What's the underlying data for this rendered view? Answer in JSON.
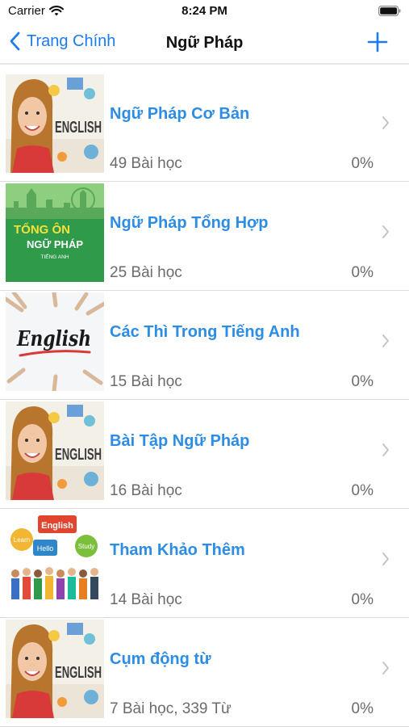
{
  "status_bar": {
    "carrier": "Carrier",
    "time": "8:24 PM"
  },
  "nav": {
    "back_label": "Trang Chính",
    "title": "Ngữ Pháp"
  },
  "courses": [
    {
      "title": "Ngữ Pháp Cơ Bản",
      "lessons": "49 Bài học",
      "progress": "0%"
    },
    {
      "title": "Ngữ Pháp Tổng Hợp",
      "lessons": "25 Bài học",
      "progress": "0%"
    },
    {
      "title": "Các Thì Trong Tiếng Anh",
      "lessons": "15 Bài học",
      "progress": "0%"
    },
    {
      "title": "Bài Tập Ngữ Pháp",
      "lessons": "16 Bài học",
      "progress": "0%"
    },
    {
      "title": "Tham Khảo Thêm",
      "lessons": "14 Bài học",
      "progress": "0%"
    },
    {
      "title": "Cụm động từ",
      "lessons": "7 Bài học, 339 Từ",
      "progress": "0%"
    }
  ],
  "thumbnails": {
    "english_girl_text": "ENGLISH",
    "tong_on_line1": "TỔNG ÔN",
    "tong_on_line2": "NGỮ PHÁP",
    "tong_on_line3": "TIẾNG ANH",
    "handwritten": "English",
    "bubbles": [
      "English",
      "Learn",
      "Hello",
      "Study"
    ]
  },
  "colors": {
    "accent": "#1a7cf0",
    "title_blue": "#2d8ce3",
    "secondary_text": "#6b6b6b",
    "thumb_green": "#2e9a4a"
  }
}
